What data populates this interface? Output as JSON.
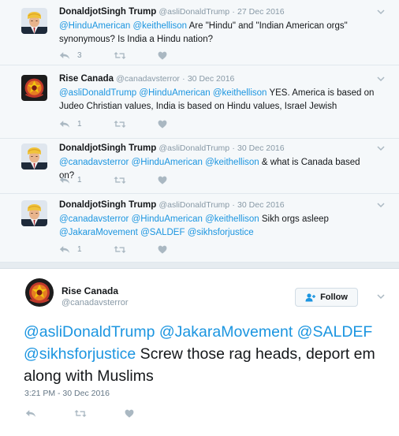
{
  "colors": {
    "link": "#1b95e0",
    "muted": "#8899a6",
    "action": "#aab8c2",
    "bg_reply": "#f5f8fa"
  },
  "replies": [
    {
      "fullname": "DonaldjotSingh Trump",
      "username": "@asliDonaldTrump",
      "separator": "·",
      "time": "27 Dec 2016",
      "segments": [
        {
          "type": "mention",
          "text": "@HinduAmerican"
        },
        {
          "type": "text",
          "text": " "
        },
        {
          "type": "mention",
          "text": "@keithellison"
        },
        {
          "type": "text",
          "text": " Are \"Hindu\" and \"Indian American orgs\" synonymous? Is India a Hindu nation?"
        }
      ],
      "reply_count": "3",
      "avatar": "trump-turban-avatar"
    },
    {
      "fullname": "Rise Canada",
      "username": "@canadavsterror",
      "separator": "·",
      "time": "30 Dec 2016",
      "segments": [
        {
          "type": "mention",
          "text": "@asliDonaldTrump"
        },
        {
          "type": "text",
          "text": " "
        },
        {
          "type": "mention",
          "text": "@HinduAmerican"
        },
        {
          "type": "text",
          "text": " "
        },
        {
          "type": "mention",
          "text": "@keithellison"
        },
        {
          "type": "text",
          "text": " YES. America is based on Judeo Christian values, India is based on Hindu values, Israel Jewish"
        }
      ],
      "reply_count": "1",
      "avatar": "rise-canada-logo"
    },
    {
      "fullname": "DonaldjotSingh Trump",
      "username": "@asliDonaldTrump",
      "separator": "·",
      "time": "30 Dec 2016",
      "segments": [
        {
          "type": "mention",
          "text": "@canadavsterror"
        },
        {
          "type": "text",
          "text": " "
        },
        {
          "type": "mention",
          "text": "@HinduAmerican"
        },
        {
          "type": "text",
          "text": " "
        },
        {
          "type": "mention",
          "text": "@keithellison"
        },
        {
          "type": "text",
          "text": " & what is Canada based on?"
        }
      ],
      "reply_count": "1",
      "avatar": "trump-turban-avatar"
    },
    {
      "fullname": "DonaldjotSingh Trump",
      "username": "@asliDonaldTrump",
      "separator": "·",
      "time": "30 Dec 2016",
      "segments": [
        {
          "type": "mention",
          "text": "@canadavsterror"
        },
        {
          "type": "text",
          "text": " "
        },
        {
          "type": "mention",
          "text": "@HinduAmerican"
        },
        {
          "type": "text",
          "text": " "
        },
        {
          "type": "mention",
          "text": "@keithellison"
        },
        {
          "type": "text",
          "text": " Sikh orgs asleep "
        },
        {
          "type": "mention",
          "text": "@JakaraMovement"
        },
        {
          "type": "text",
          "text": " "
        },
        {
          "type": "mention",
          "text": "@SALDEF"
        },
        {
          "type": "text",
          "text": " "
        },
        {
          "type": "mention",
          "text": "@sikhsforjustice"
        }
      ],
      "reply_count": "1",
      "avatar": "trump-turban-avatar"
    }
  ],
  "main_tweet": {
    "fullname": "Rise Canada",
    "username": "@canadavsterror",
    "follow_label": "Follow",
    "segments": [
      {
        "type": "mention",
        "text": "@asliDonaldTrump"
      },
      {
        "type": "text",
        "text": "  "
      },
      {
        "type": "mention",
        "text": "@JakaraMovement"
      },
      {
        "type": "text",
        "text": " "
      },
      {
        "type": "mention",
        "text": "@SALDEF"
      },
      {
        "type": "text",
        "text": " "
      },
      {
        "type": "mention",
        "text": "@sikhsforjustice"
      },
      {
        "type": "text",
        "text": " Screw those rag heads, deport em along with Muslims"
      }
    ],
    "timestamp": "3:21 PM - 30 Dec 2016",
    "avatar": "rise-canada-logo"
  }
}
